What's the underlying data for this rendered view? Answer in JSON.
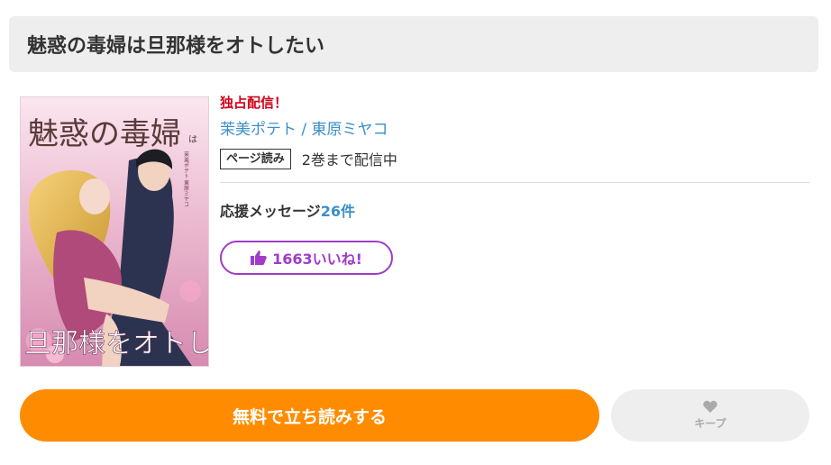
{
  "page": {
    "title": "魅惑の毒婦は旦那様をオトしたい"
  },
  "cover": {
    "title_top": "魅惑の毒婦",
    "title_small": "は",
    "title_bottom": "旦那様をオトしたい",
    "credits": "茉美ポテト 東原ミヤコ"
  },
  "info": {
    "exclusive": "独占配信！",
    "author1": "茉美ポテト",
    "separator": " / ",
    "author2": "東原ミヤコ",
    "badge": "ページ読み",
    "volumes": "2巻まで配信中",
    "support_label": "応援メッセージ",
    "support_count": "26件",
    "like_label": "1663いいね!"
  },
  "actions": {
    "read_label": "無料で立ち読みする",
    "keep_label": "キープ"
  },
  "colors": {
    "accent_orange": "#ff8c00",
    "like_purple": "#a03cc8",
    "link_blue": "#3a8fc9",
    "exclusive_red": "#d0021b"
  }
}
